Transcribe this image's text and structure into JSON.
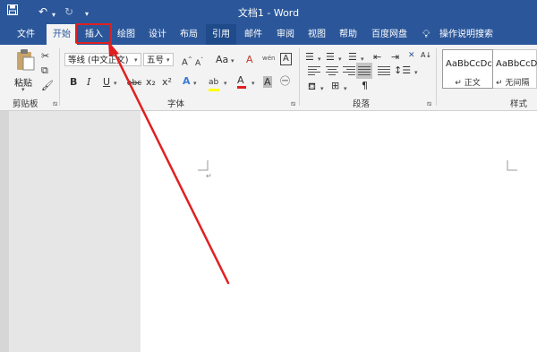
{
  "window": {
    "title": "文档1  -  Word",
    "save_icon": "save-icon",
    "undo_icon": "undo-icon",
    "redo_icon": "redo-icon",
    "customize_icon": "qat-customize-icon"
  },
  "tabs": [
    {
      "label": "文件"
    },
    {
      "label": "开始"
    },
    {
      "label": "插入"
    },
    {
      "label": "绘图"
    },
    {
      "label": "设计"
    },
    {
      "label": "布局"
    },
    {
      "label": "引用"
    },
    {
      "label": "邮件"
    },
    {
      "label": "审阅"
    },
    {
      "label": "视图"
    },
    {
      "label": "帮助"
    },
    {
      "label": "百度网盘"
    }
  ],
  "search": {
    "label": "操作说明搜索",
    "icon": "lightbulb-icon"
  },
  "ribbon": {
    "clipboard": {
      "label": "剪贴板",
      "paste_label": "粘贴"
    },
    "font": {
      "label": "字体",
      "font_name": "等线 (中文正文)",
      "font_size": "五号",
      "bold": "B",
      "italic": "I",
      "underline": "U",
      "strike": "abc",
      "subscript": "x₂",
      "superscript": "x²",
      "clear": "A",
      "phonetic": "wén",
      "border": "A"
    },
    "paragraph": {
      "label": "段落"
    },
    "styles": {
      "label": "样式",
      "items": [
        {
          "sample": "AaBbCcDc",
          "name": "↵ 正文"
        },
        {
          "sample": "AaBbCcDc",
          "name": "↵ 无间隔"
        }
      ]
    }
  },
  "highlight": {
    "color": "#e02020",
    "target_tab": "插入"
  },
  "colors": {
    "title_bar": "#2b579a",
    "ribbon_bg": "#f3f3f3",
    "page": "#ffffff",
    "arrow": "#e02020"
  }
}
